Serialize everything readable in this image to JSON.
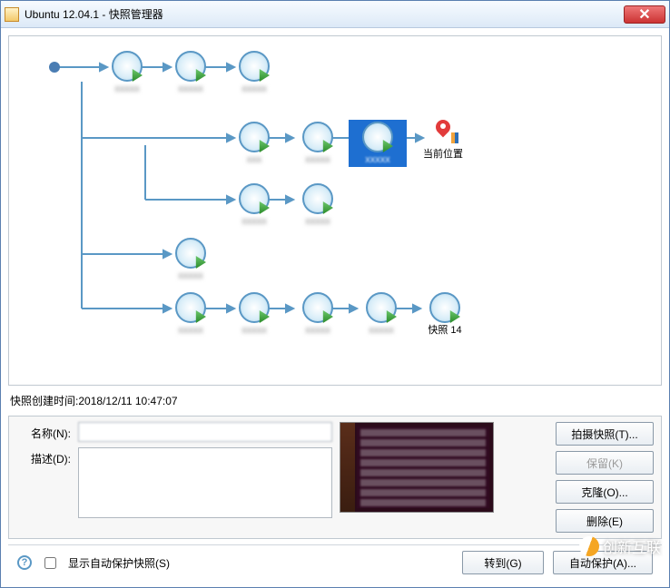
{
  "window": {
    "title": "Ubuntu 12.04.1 - 快照管理器"
  },
  "tree": {
    "current_location": "当前位置",
    "snapshot14": "快照 14"
  },
  "details": {
    "timestamp_label": "快照创建时间:",
    "timestamp_value": "2018/12/11 10:47:07",
    "name_label": "名称(N):",
    "name_value": "",
    "desc_label": "描述(D):",
    "desc_value": ""
  },
  "buttons": {
    "take": "拍摄快照(T)...",
    "keep": "保留(K)",
    "clone": "克隆(O)...",
    "delete": "删除(E)",
    "goto": "转到(G)",
    "autoprotect": "自动保护(A)..."
  },
  "bottombar": {
    "show_autoprotect": "显示自动保护快照(S)"
  },
  "watermark": "创新互联"
}
